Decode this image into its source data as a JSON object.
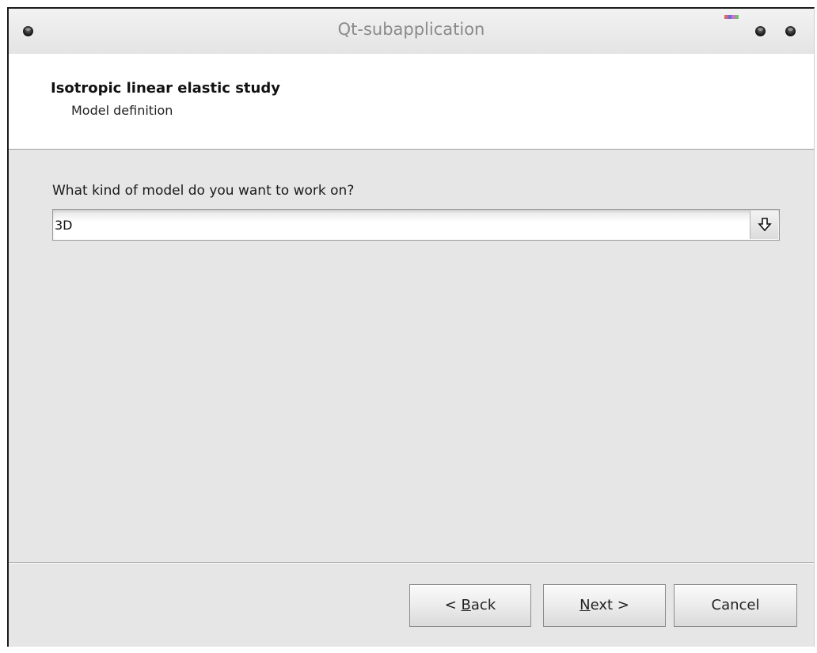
{
  "window": {
    "title": "Qt-subapplication"
  },
  "header": {
    "title": "Isotropic linear elastic study",
    "subtitle": "Model definition"
  },
  "content": {
    "question": "What kind of model do you want to work on?",
    "model_select": {
      "value": "3D",
      "button_icon": "arrow-down-icon"
    }
  },
  "buttons": {
    "back": {
      "prefix": "< ",
      "mnemonic": "B",
      "rest": "ack"
    },
    "next": {
      "mnemonic": "N",
      "rest": "ext >"
    },
    "cancel": "Cancel"
  },
  "colors": {
    "window_bg": "#e6e6e6",
    "header_bg": "#ffffff",
    "title_text": "#8a8a8a"
  }
}
